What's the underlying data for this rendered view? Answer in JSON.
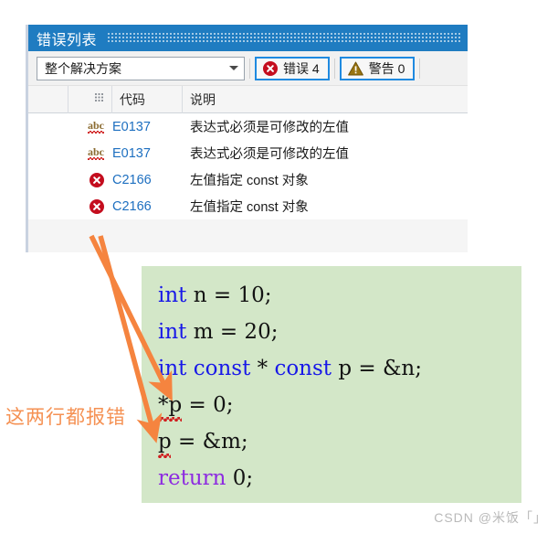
{
  "panel": {
    "title": "错误列表",
    "toolbar": {
      "scope_value": "整个解决方案",
      "scope_options": [
        "整个解决方案"
      ],
      "errors_label": "错误 4",
      "warnings_label": "警告 0"
    },
    "grid": {
      "headers": {
        "blank": "",
        "icon": "",
        "code": "代码",
        "description": "说明"
      },
      "rows": [
        {
          "icon": "abc-icon",
          "icon_text": "abc",
          "code": "E0137",
          "description": "表达式必须是可修改的左值"
        },
        {
          "icon": "abc-icon",
          "icon_text": "abc",
          "code": "E0137",
          "description": "表达式必须是可修改的左值"
        },
        {
          "icon": "error-icon",
          "icon_text": "",
          "code": "C2166",
          "description": "左值指定 const 对象"
        },
        {
          "icon": "error-icon",
          "icon_text": "",
          "code": "C2166",
          "description": "左值指定 const 对象"
        }
      ]
    }
  },
  "code": {
    "lines": [
      {
        "id": "line-1",
        "tokens": [
          {
            "text": "int",
            "style": "kw"
          },
          {
            "text": " n = 10;",
            "style": "pln"
          }
        ]
      },
      {
        "id": "line-2",
        "tokens": [
          {
            "text": "int",
            "style": "kw"
          },
          {
            "text": " m = 20;",
            "style": "pln"
          }
        ]
      },
      {
        "id": "line-3",
        "tokens": [
          {
            "text": "int const",
            "style": "kw"
          },
          {
            "text": " * ",
            "style": "pln"
          },
          {
            "text": "const",
            "style": "kw"
          },
          {
            "text": " p = &n;",
            "style": "pln"
          }
        ]
      },
      {
        "id": "line-4",
        "tokens": [
          {
            "text": "*p = 0;",
            "style": "pln"
          }
        ],
        "squiggle": {
          "left": 0,
          "width": 26
        }
      },
      {
        "id": "line-5",
        "tokens": [
          {
            "text": "p = &m;",
            "style": "pln"
          }
        ],
        "squiggle": {
          "left": 0,
          "width": 14
        }
      },
      {
        "id": "line-6",
        "tokens": [
          {
            "text": "return",
            "style": "kw2"
          },
          {
            "text": " 0;",
            "style": "pln"
          }
        ]
      }
    ]
  },
  "annotation": {
    "text": "这两行都报错",
    "color": "#f59153"
  },
  "watermark": {
    "text": "CSDN @米饭「」"
  },
  "colors": {
    "titlebar": "#1f7cc1",
    "code_background": "#d3e7c8",
    "error_red": "#c40d1e",
    "warning_gold": "#9a7510",
    "code_link_blue": "#1d6fc0",
    "keyword_blue": "#1818e8",
    "keyword_purple": "#8d2be0",
    "button_border_blue": "#1f8ae0"
  }
}
